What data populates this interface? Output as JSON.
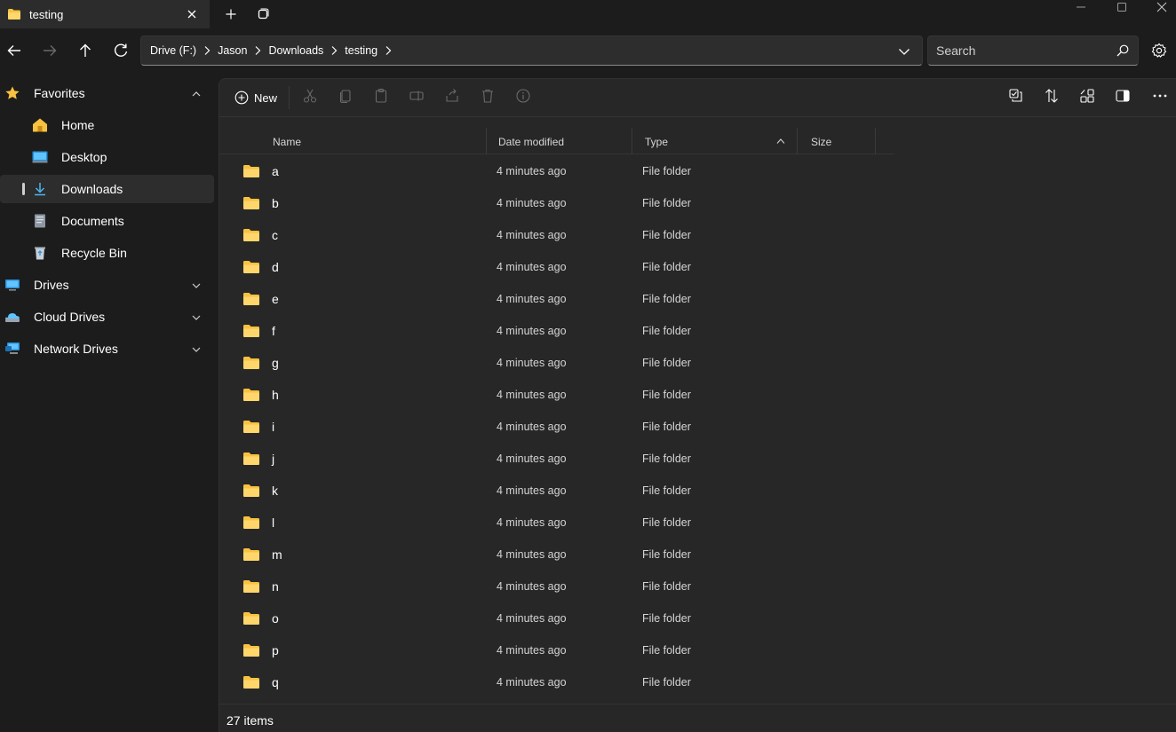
{
  "window": {
    "tab_title": "testing"
  },
  "address": {
    "crumbs": [
      "Drive (F:)",
      "Jason",
      "Downloads",
      "testing"
    ]
  },
  "search": {
    "placeholder": "Search"
  },
  "sidebar": {
    "items": [
      {
        "label": "Favorites",
        "icon": "star-icon",
        "expanded": true
      },
      {
        "label": "Home",
        "icon": "home-icon"
      },
      {
        "label": "Desktop",
        "icon": "desktop-icon"
      },
      {
        "label": "Downloads",
        "icon": "download-icon",
        "selected": true
      },
      {
        "label": "Documents",
        "icon": "documents-icon"
      },
      {
        "label": "Recycle Bin",
        "icon": "recycle-bin-icon"
      },
      {
        "label": "Drives",
        "icon": "drives-icon",
        "expanded": false
      },
      {
        "label": "Cloud Drives",
        "icon": "cloud-drives-icon",
        "expanded": false
      },
      {
        "label": "Network Drives",
        "icon": "network-drives-icon",
        "expanded": false
      }
    ]
  },
  "toolbar": {
    "new_label": "New"
  },
  "columns": {
    "name": "Name",
    "date": "Date modified",
    "type": "Type",
    "size": "Size"
  },
  "files": [
    {
      "name": "a",
      "date": "4 minutes ago",
      "type": "File folder"
    },
    {
      "name": "b",
      "date": "4 minutes ago",
      "type": "File folder"
    },
    {
      "name": "c",
      "date": "4 minutes ago",
      "type": "File folder"
    },
    {
      "name": "d",
      "date": "4 minutes ago",
      "type": "File folder"
    },
    {
      "name": "e",
      "date": "4 minutes ago",
      "type": "File folder"
    },
    {
      "name": "f",
      "date": "4 minutes ago",
      "type": "File folder"
    },
    {
      "name": "g",
      "date": "4 minutes ago",
      "type": "File folder"
    },
    {
      "name": "h",
      "date": "4 minutes ago",
      "type": "File folder"
    },
    {
      "name": "i",
      "date": "4 minutes ago",
      "type": "File folder"
    },
    {
      "name": "j",
      "date": "4 minutes ago",
      "type": "File folder"
    },
    {
      "name": "k",
      "date": "4 minutes ago",
      "type": "File folder"
    },
    {
      "name": "l",
      "date": "4 minutes ago",
      "type": "File folder"
    },
    {
      "name": "m",
      "date": "4 minutes ago",
      "type": "File folder"
    },
    {
      "name": "n",
      "date": "4 minutes ago",
      "type": "File folder"
    },
    {
      "name": "o",
      "date": "4 minutes ago",
      "type": "File folder"
    },
    {
      "name": "p",
      "date": "4 minutes ago",
      "type": "File folder"
    },
    {
      "name": "q",
      "date": "4 minutes ago",
      "type": "File folder"
    }
  ],
  "status": {
    "item_count": "27 items"
  },
  "colors": {
    "folder": "#f8c241",
    "accent": "#60cdff"
  }
}
